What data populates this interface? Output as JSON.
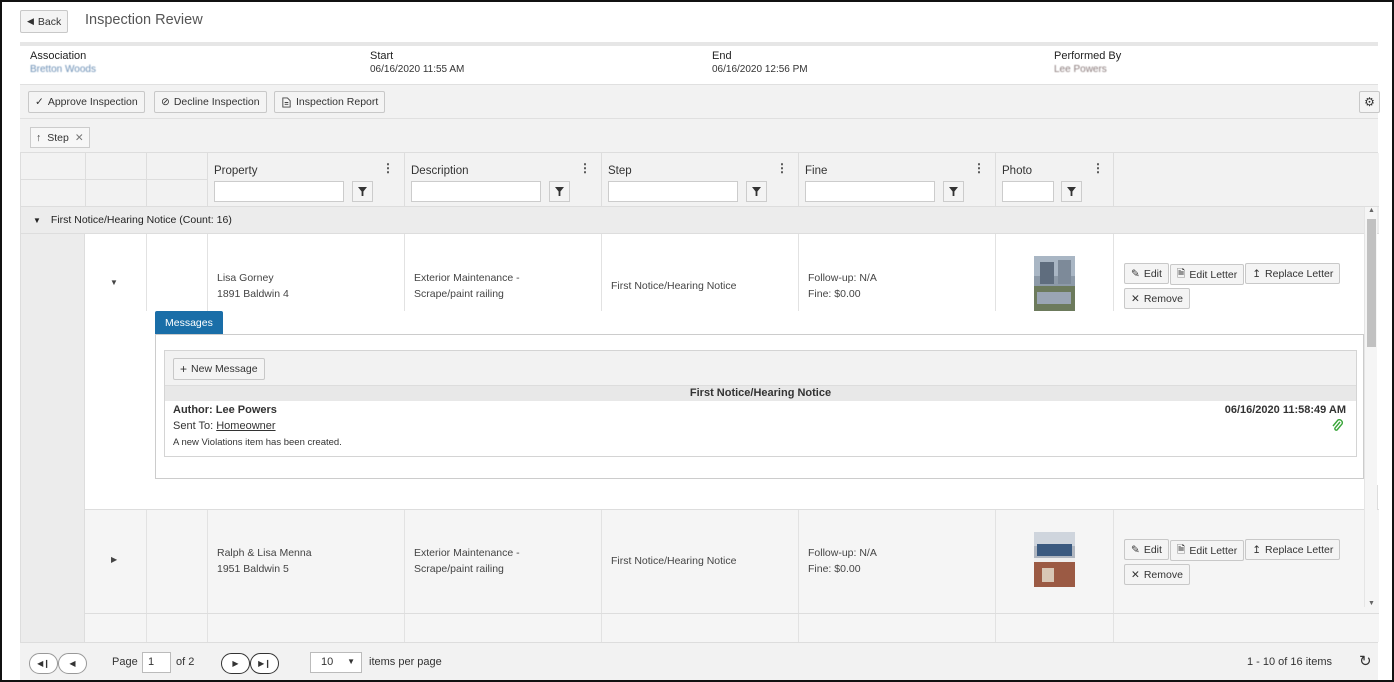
{
  "header": {
    "back_label": "Back",
    "title": "Inspection Review"
  },
  "info": {
    "association_label": "Association",
    "association_value": "Bretton Woods",
    "start_label": "Start",
    "start_value": "06/16/2020 11:55 AM",
    "end_label": "End",
    "end_value": "06/16/2020 12:56 PM",
    "performed_label": "Performed By",
    "performed_value": "Lee Powers"
  },
  "toolbar": {
    "approve": "Approve Inspection",
    "decline": "Decline Inspection",
    "report": "Inspection Report"
  },
  "grouping": {
    "chip": "Step"
  },
  "columns": {
    "property": "Property",
    "description": "Description",
    "step": "Step",
    "fine": "Fine",
    "photo": "Photo"
  },
  "group": {
    "label": "First Notice/Hearing Notice (Count: 16)"
  },
  "rows": [
    {
      "name": "Lisa Gorney",
      "address": "1891 Baldwin 4",
      "desc1": "Exterior Maintenance -",
      "desc2": "Scrape/paint railing",
      "step": "First Notice/Hearing Notice",
      "followup": "Follow-up: N/A",
      "fine": "Fine: $0.00"
    },
    {
      "name": "Ralph & Lisa Menna",
      "address": "1951 Baldwin 5",
      "desc1": "Exterior Maintenance -",
      "desc2": "Scrape/paint railing",
      "step": "First Notice/Hearing Notice",
      "followup": "Follow-up: N/A",
      "fine": "Fine: $0.00"
    }
  ],
  "row_actions": {
    "edit": "Edit",
    "edit_letter": "Edit Letter",
    "replace_letter": "Replace Letter",
    "remove": "Remove"
  },
  "messages": {
    "tab": "Messages",
    "new_message": "New Message",
    "heading": "First Notice/Hearing Notice",
    "author": "Author: Lee Powers",
    "sent_to_label": "Sent To:",
    "sent_to": "Homeowner",
    "timestamp": "06/16/2020 11:58:49 AM",
    "body": "A new Violations item has been created."
  },
  "pager": {
    "page_label": "Page",
    "page": "1",
    "of": "of 2",
    "page_size": "10",
    "per_page": "items per page",
    "summary": "1 - 10 of 16 items"
  },
  "colors": {
    "accent": "#1a6ea8",
    "attachment": "#3aa63a"
  }
}
